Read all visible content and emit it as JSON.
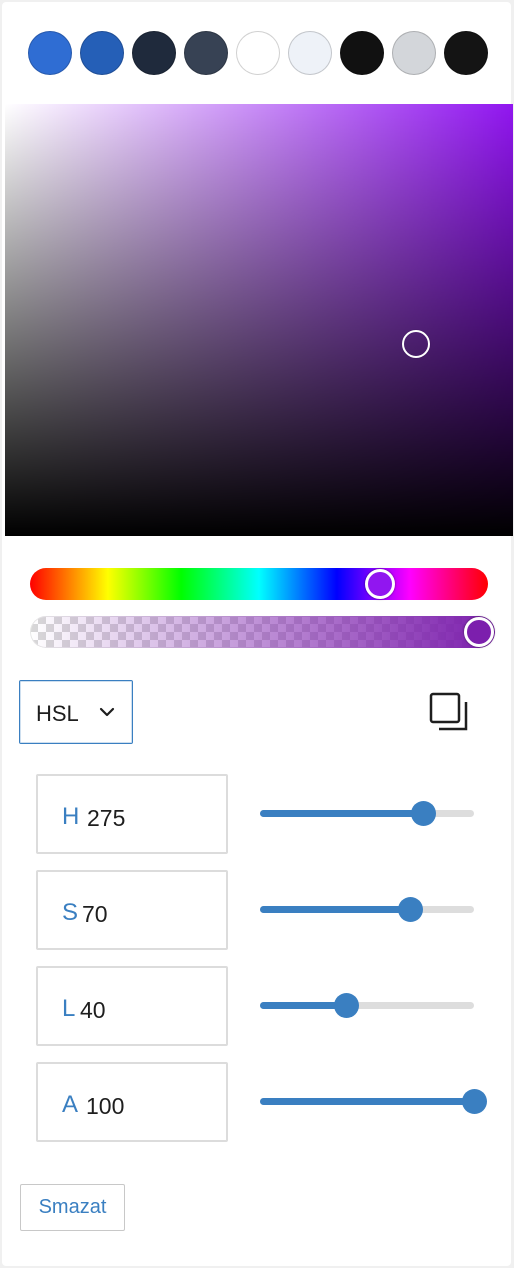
{
  "swatches": [
    "#2f6dd3",
    "#255fb7",
    "#1f2a3c",
    "#374254",
    "#ffffff",
    "#eef2f8",
    "#111111",
    "#d3d6da",
    "#141414"
  ],
  "picker": {
    "hue_color": "#9116f0",
    "current_color": "#7c1fad",
    "hue_value": 275,
    "alpha_value": 100
  },
  "format_select": {
    "value": "HSL"
  },
  "fields": [
    {
      "letter": "H",
      "value": "275",
      "max": 360
    },
    {
      "letter": "S",
      "value": "70",
      "max": 100
    },
    {
      "letter": "L",
      "value": "40",
      "max": 100
    },
    {
      "letter": "A",
      "value": "100",
      "max": 100
    }
  ],
  "clear_button": {
    "label": "Smazat"
  },
  "accent_color": "#3a7fc1"
}
